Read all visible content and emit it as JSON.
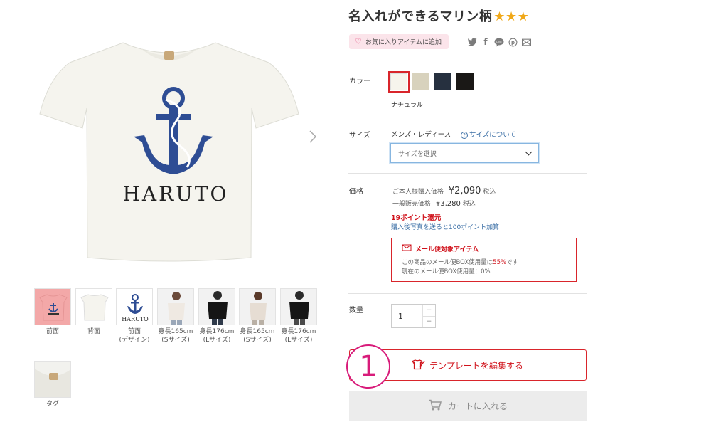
{
  "product": {
    "title": "名入れができるマリン柄",
    "stars": "★★★",
    "shirt_text": "HARUTO",
    "favorite_label": "お気に入りアイテムに追加"
  },
  "share_icons": [
    "twitter-icon",
    "facebook-icon",
    "line-icon",
    "pinterest-icon",
    "mail-icon"
  ],
  "gallery": {
    "thumbs": [
      {
        "caption": "前面",
        "bg": "#f3a8a8"
      },
      {
        "caption": "背面",
        "bg": "#f2f2ee"
      },
      {
        "caption": "前面\n(デザイン)",
        "bg": "#ffffff"
      },
      {
        "caption": "身長165cm\n(Sサイズ)",
        "bg": "#f2f2f2"
      },
      {
        "caption": "身長176cm\n(Lサイズ)",
        "bg": "#f2f2f2"
      },
      {
        "caption": "身長165cm\n(Sサイズ)",
        "bg": "#f2f2f2"
      },
      {
        "caption": "身長176cm\n(Lサイズ)",
        "bg": "#f2f2f2"
      },
      {
        "caption": "タグ",
        "bg": "#f2f2ee"
      }
    ]
  },
  "color": {
    "label": "カラー",
    "selected_name": "ナチュラル",
    "swatches": [
      "#f6f4ec",
      "#d8d2bd",
      "#26303f",
      "#1a1816"
    ]
  },
  "size": {
    "label": "サイズ",
    "type": "メンズ・レディース",
    "help_link": "サイズについて",
    "select_placeholder": "サイズを選択"
  },
  "price": {
    "label": "価格",
    "member_label": "ご本人様購入価格",
    "member_price": "¥2,090",
    "member_tax": "税込",
    "general_label": "一般販売価格",
    "general_price": "¥3,280",
    "general_tax": "税込",
    "points": "19ポイント還元",
    "points_link": "購入後写真を送ると100ポイント加算"
  },
  "mail": {
    "title": "メール便対象アイテム",
    "line1_pre": "この商品のメール便BOX使用量は",
    "line1_pct": "55%",
    "line1_post": "です",
    "line2": "現在のメール便BOX使用量：0%"
  },
  "quantity": {
    "label": "数量",
    "value": "1",
    "plus": "+",
    "minus": "−"
  },
  "actions": {
    "edit_template": "テンプレートを編集する",
    "add_to_cart": "カートに入れる",
    "annotation_number": "1"
  },
  "colors": {
    "accent_red": "#d9252b",
    "annotation_pink": "#d81b7a",
    "anchor_navy": "#2e4d94"
  }
}
